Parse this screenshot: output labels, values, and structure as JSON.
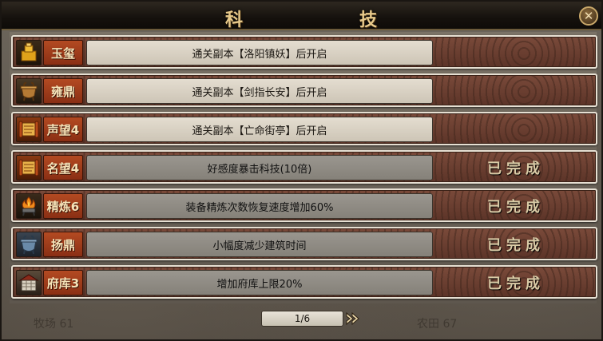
{
  "title": {
    "char1": "科",
    "char2": "技"
  },
  "close_icon": "close-icon",
  "background_text": {
    "left": "牧场 61",
    "right": "农田 67"
  },
  "rows": [
    {
      "icon": "jade-seal-icon",
      "name": "玉玺",
      "desc": "通关副本【洛阳镇妖】后开启",
      "status": "",
      "state": "locked"
    },
    {
      "icon": "bronze-cauldron-icon",
      "name": "雍鼎",
      "desc": "通关副本【剑指长安】后开启",
      "status": "",
      "state": "locked"
    },
    {
      "icon": "scroll-icon",
      "name": "声望4",
      "desc": "通关副本【亡命街亭】后开启",
      "status": "",
      "state": "locked"
    },
    {
      "icon": "scroll-icon",
      "name": "名望4",
      "desc": "好感度暴击科技(10倍)",
      "status": "已完成",
      "state": "done"
    },
    {
      "icon": "fire-brazier-icon",
      "name": "精炼6",
      "desc": "装备精炼次数恢复速度增加60%",
      "status": "已完成",
      "state": "done"
    },
    {
      "icon": "blue-cauldron-icon",
      "name": "扬鼎",
      "desc": "小幅度减少建筑时间",
      "status": "已完成",
      "state": "done"
    },
    {
      "icon": "treasury-icon",
      "name": "府库3",
      "desc": "增加府库上限20%",
      "status": "已完成",
      "state": "done"
    }
  ],
  "pager": {
    "label": "1/6"
  },
  "colors": {
    "name_badge": "#a83f1c",
    "row_bg": "#6e4134",
    "status_text": "#d9cba6"
  }
}
